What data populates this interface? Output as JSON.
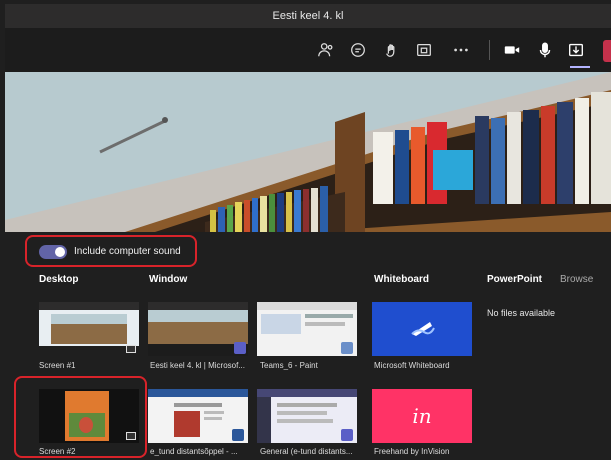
{
  "window": {
    "title": "Eesti keel 4. kl"
  },
  "toolbar": {
    "icons": [
      "people-icon",
      "chat-icon",
      "reactions-icon",
      "rooms-icon",
      "more-icon",
      "camera-icon",
      "mic-icon",
      "share-icon",
      "hangup-icon"
    ]
  },
  "share": {
    "include_sound_label": "Include computer sound",
    "include_sound_on": true,
    "sections": {
      "desktop": "Desktop",
      "window": "Window",
      "whiteboard": "Whiteboard",
      "powerpoint": "PowerPoint",
      "browse": "Browse"
    },
    "no_files": "No files available",
    "items": [
      {
        "label": "Screen #1"
      },
      {
        "label": "Eesti keel 4. kl | Microsof..."
      },
      {
        "label": "Teams_6 - Paint"
      },
      {
        "label": "Microsoft Whiteboard"
      },
      {
        "label": "Screen #2"
      },
      {
        "label": "e_tund distantsõppel - ..."
      },
      {
        "label": "General (e-tund distants..."
      },
      {
        "label": "Freehand by InVision"
      }
    ],
    "invision_logo_text": "in"
  },
  "colors": {
    "accent": "#6264a7",
    "highlight": "#d8232a",
    "hangup": "#c4314b",
    "whiteboard": "#1f4ecf",
    "invision": "#ff3366"
  }
}
